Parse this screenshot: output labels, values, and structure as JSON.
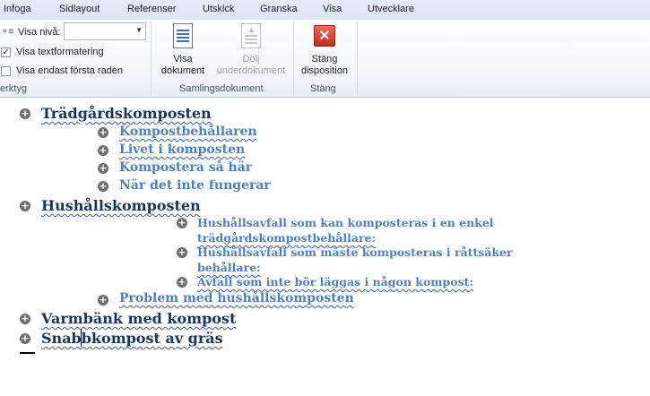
{
  "tabs": [
    "Infoga",
    "Sidlayout",
    "Referenser",
    "Utskick",
    "Granska",
    "Visa",
    "Utvecklare"
  ],
  "ribbon": {
    "tools": {
      "level_label": "Visa nivå:",
      "level_value": "",
      "show_formatting": "Visa textformatering",
      "show_formatting_checked": true,
      "first_line_only": "Visa endast första raden",
      "first_line_only_checked": false,
      "group_label": "erktyg"
    },
    "master": {
      "show_document": [
        "Visa",
        "dokument"
      ],
      "hide_subdocuments": [
        "Dölj",
        "underdokument"
      ],
      "group_label": "Samlingsdokument"
    },
    "close": {
      "close_outline": [
        "Stäng",
        "disposition"
      ],
      "group_label": "Stäng"
    }
  },
  "outline": [
    {
      "level": 1,
      "text": "Trädgårdskomposten"
    },
    {
      "level": 2,
      "text": "Kompostbehållaren"
    },
    {
      "level": 2,
      "text": "Livet i komposten"
    },
    {
      "level": 2,
      "text": "Kompostera så här"
    },
    {
      "level": 2,
      "text": "När det inte fungerar"
    },
    {
      "level": 1,
      "text": "Hushållskomposten"
    },
    {
      "level": 3,
      "text": "Hushållsavfall som kan komposteras i en enkel"
    },
    {
      "level": 3,
      "text": "trädgårdskompostbehållare:"
    },
    {
      "level": 3,
      "text": "Hushållsavfall som måste komposteras i råttsäker"
    },
    {
      "level": 3,
      "text": "behållare:"
    },
    {
      "level": 3,
      "text": "Avfall som inte bör läggas i någon kompost:"
    },
    {
      "level": 2,
      "text": "Problem med hushållskomposten"
    },
    {
      "level": 1,
      "text": "Varmbänk med kompost"
    },
    {
      "level": 1,
      "text": "Snabbkompost av gräs"
    }
  ]
}
